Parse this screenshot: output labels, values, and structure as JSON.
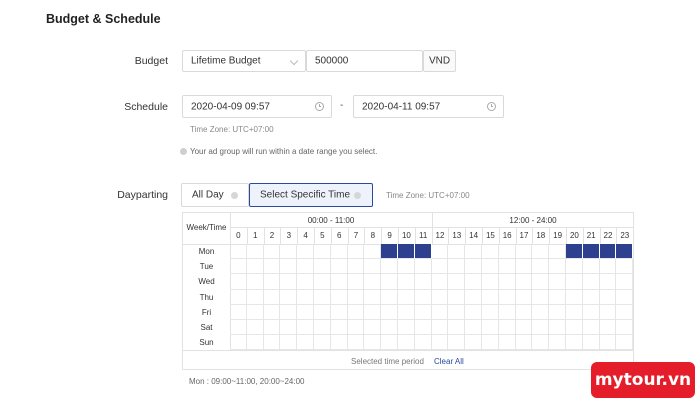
{
  "section": {
    "title": "Budget & Schedule"
  },
  "budget": {
    "label": "Budget",
    "type_value": "Lifetime Budget",
    "amount_value": "500000",
    "currency": "VND"
  },
  "schedule": {
    "label": "Schedule",
    "start": "2020-04-09 09:57",
    "separator": "-",
    "end": "2020-04-11 09:57",
    "timezone": "Time Zone: UTC+07:00",
    "note": "Your ad group will run within a date range you select."
  },
  "dayparting": {
    "label": "Dayparting",
    "all_day_label": "All Day",
    "specific_label": "Select Specific Time",
    "timezone": "Time Zone: UTC+07:00",
    "corner_label": "Week/Time",
    "range_am": "00:00 - 11:00",
    "range_pm": "12:00 - 24:00",
    "hours": [
      "0",
      "1",
      "2",
      "3",
      "4",
      "5",
      "6",
      "7",
      "8",
      "9",
      "10",
      "11",
      "12",
      "13",
      "14",
      "15",
      "16",
      "17",
      "18",
      "19",
      "20",
      "21",
      "22",
      "23"
    ],
    "days": [
      "Mon",
      "Tue",
      "Wed",
      "Thu",
      "Fri",
      "Sat",
      "Sun"
    ],
    "selected": {
      "Mon": [
        9,
        10,
        11,
        20,
        21,
        22,
        23
      ]
    },
    "selected_period_label": "Selected time period",
    "clear_all_label": "Clear All",
    "summary": "Mon :   09:00~11:00,   20:00~24:00"
  },
  "brand": {
    "text": "mytour.vn",
    "color": "#e51d2a"
  },
  "colors": {
    "selected_cell": "#2d3f8f",
    "accent": "#2b4a9e"
  }
}
